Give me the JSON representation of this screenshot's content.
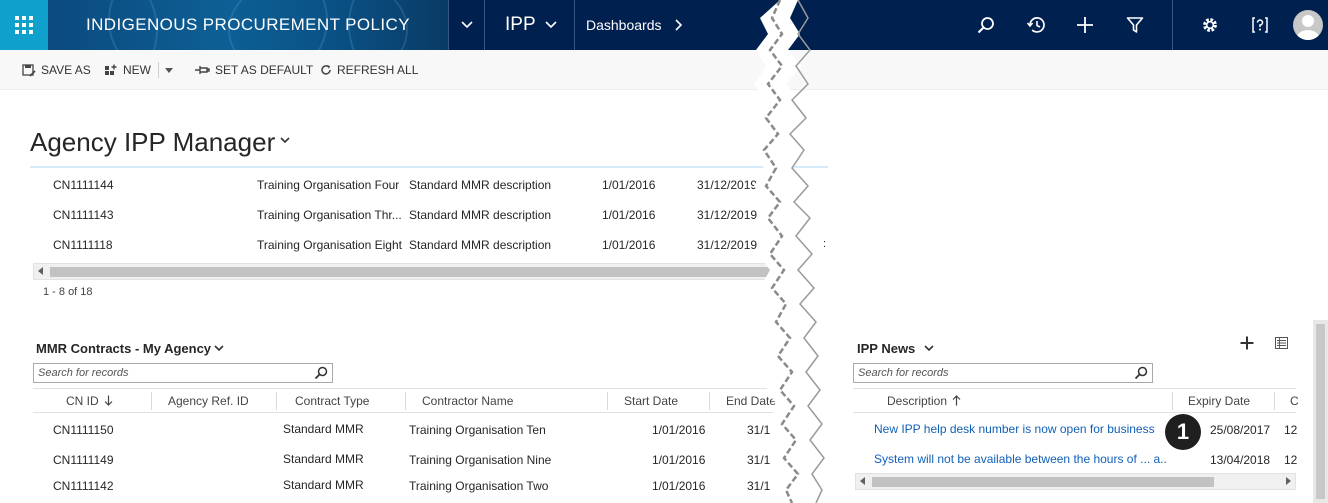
{
  "nav": {
    "app_title": "INDIGENOUS PROCUREMENT POLICY",
    "area": "IPP",
    "breadcrumb": "Dashboards"
  },
  "commands": {
    "save_as": "SAVE AS",
    "new": "NEW",
    "set_default": "SET AS DEFAULT",
    "refresh_all": "REFRESH ALL"
  },
  "dashboard": {
    "title": "Agency IPP Manager"
  },
  "top_grid": {
    "rows": [
      {
        "id": "CN1111144",
        "contractor": "Training Organisation Four",
        "description": "Standard MMR description",
        "start": "1/01/2016",
        "end": "31/12/2019"
      },
      {
        "id": "CN1111143",
        "contractor": "Training Organisation Thr...",
        "description": "Standard MMR description",
        "start": "1/01/2016",
        "end": "31/12/2019"
      },
      {
        "id": "CN1111118",
        "contractor": "Training Organisation Eight",
        "description": "Standard MMR description",
        "start": "1/01/2016",
        "end": "31/12/2019"
      }
    ],
    "record_count": "1 - 8 of 18"
  },
  "mmr": {
    "title": "MMR Contracts - My Agency",
    "search_placeholder": "Search for records",
    "columns": [
      "CN ID",
      "Agency Ref. ID",
      "Contract Type",
      "Contractor Name",
      "Start Date",
      "End Date"
    ],
    "rows": [
      {
        "id": "CN1111150",
        "type": "Standard MMR",
        "contractor": "Training Organisation Ten",
        "start": "1/01/2016",
        "end": "31/1"
      },
      {
        "id": "CN1111149",
        "type": "Standard MMR",
        "contractor": "Training Organisation Nine",
        "start": "1/01/2016",
        "end": "31/1"
      },
      {
        "id": "CN1111142",
        "type": "Standard MMR",
        "contractor": "Training Organisation Two",
        "start": "1/01/2016",
        "end": "31/1"
      }
    ]
  },
  "news": {
    "title": "IPP News",
    "search_placeholder": "Search for records",
    "columns": [
      "Description",
      "Expiry Date",
      "C"
    ],
    "rows": [
      {
        "description": "New IPP help desk number is now open for business",
        "expiry": "25/08/2017",
        "extra": "12"
      },
      {
        "description": "System will not be available between the hours of ... a...",
        "expiry": "13/04/2018",
        "extra": "12"
      }
    ]
  },
  "callout": {
    "label": "1"
  },
  "colors": {
    "navbar": "#002050",
    "app_tile": "#0fa1cc",
    "link": "#1160b7"
  },
  "icons": [
    "apps-grid-icon",
    "chevron-down-icon",
    "chevron-right-icon",
    "search-icon",
    "history-icon",
    "plus-icon",
    "filter-icon",
    "gear-icon",
    "help-icon",
    "user-avatar-icon",
    "save-as-icon",
    "new-icon",
    "pin-icon",
    "refresh-icon",
    "sort-ascending-icon",
    "sort-descending-icon",
    "view-list-icon"
  ]
}
